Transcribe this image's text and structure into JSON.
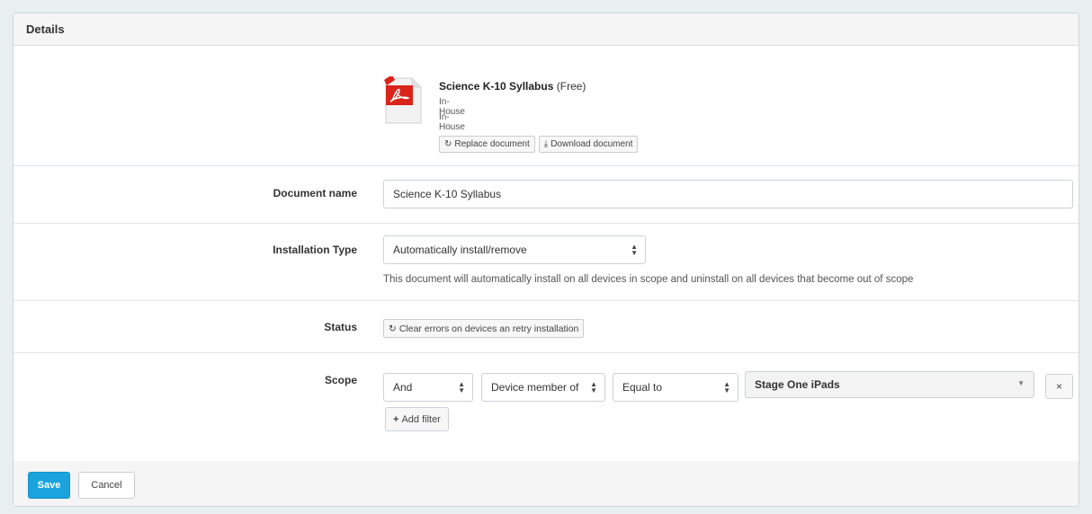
{
  "panel": {
    "title": "Details"
  },
  "document": {
    "name": "Science K-10 Syllabus",
    "price": "(Free)",
    "source_line1": "In-House",
    "source_line2": "In-House",
    "replace_label": "Replace document",
    "download_label": "Download document",
    "icon": "pdf-file-icon"
  },
  "fields": {
    "doc_name_label": "Document name",
    "doc_name_value": "Science K-10 Syllabus",
    "install_type_label": "Installation Type",
    "install_type_value": "Automatically install/remove",
    "install_help": "This document will automatically install on all devices in scope and uninstall on all devices that become out of scope",
    "status_label": "Status",
    "status_button": "Clear errors on devices an retry installation",
    "scope_label": "Scope"
  },
  "scope_filter": {
    "conjunction": "And",
    "field": "Device member of",
    "operator": "Equal to",
    "value": "Stage One iPads",
    "remove": "×",
    "add_filter_label": "Add filter"
  },
  "footer": {
    "save_label": "Save",
    "cancel_label": "Cancel"
  },
  "colors": {
    "primary": "#1aa3dd",
    "pdf_red": "#d9231b"
  }
}
